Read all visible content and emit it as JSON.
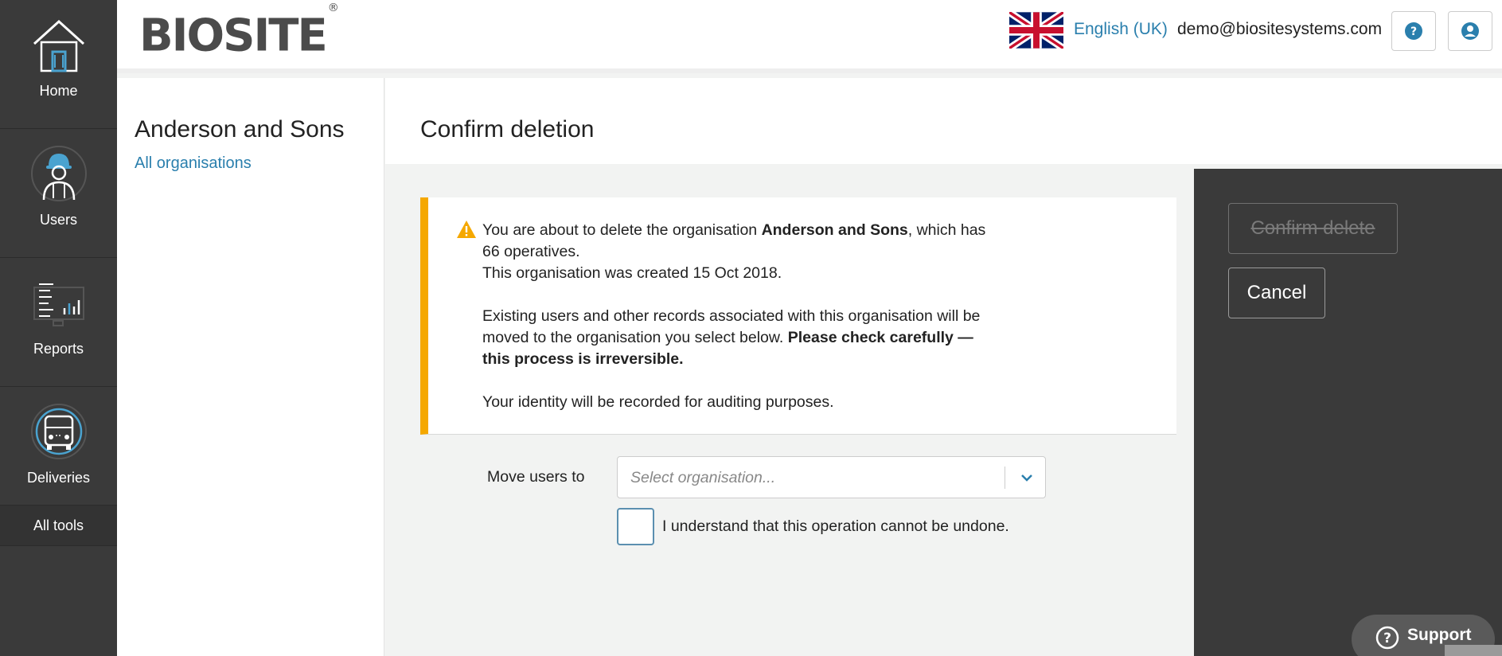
{
  "nav": {
    "items": [
      {
        "label": "Home",
        "icon": "house-icon"
      },
      {
        "label": "Users",
        "icon": "worker-icon"
      },
      {
        "label": "Reports",
        "icon": "reports-icon"
      },
      {
        "label": "Deliveries",
        "icon": "truck-icon"
      }
    ],
    "all_tools": "All tools"
  },
  "header": {
    "logo": "BIOSITE",
    "logo_mark": "®",
    "language": "English (UK)",
    "email": "demo@biositesystems.com",
    "help_icon": "question-circle-icon",
    "account_icon": "user-circle-icon"
  },
  "org": {
    "name": "Anderson and Sons",
    "all_link": "All organisations"
  },
  "page": {
    "title": "Confirm deletion"
  },
  "warning": {
    "line1_pre": "You are about to delete the organisation ",
    "org_name": "Anderson and Sons",
    "line1_post": ", which has 66 operatives.",
    "created": "This organisation was created 15 Oct 2018.",
    "para2_pre": "Existing users and other records associated with this organisation will be moved to the organisation you select below. ",
    "para2_bold": "Please check carefully — this process is irreversible.",
    "para3": "Your identity will be recorded for auditing purposes."
  },
  "form": {
    "move_label": "Move users to",
    "select_placeholder": "Select organisation...",
    "checkbox_label": "I understand that this operation cannot be undone."
  },
  "actions": {
    "confirm": "Confirm delete",
    "cancel": "Cancel"
  },
  "support": "Support",
  "colors": {
    "accent": "#2a7fad",
    "warning": "#f5a800",
    "nav_bg": "#3a3a3a"
  }
}
